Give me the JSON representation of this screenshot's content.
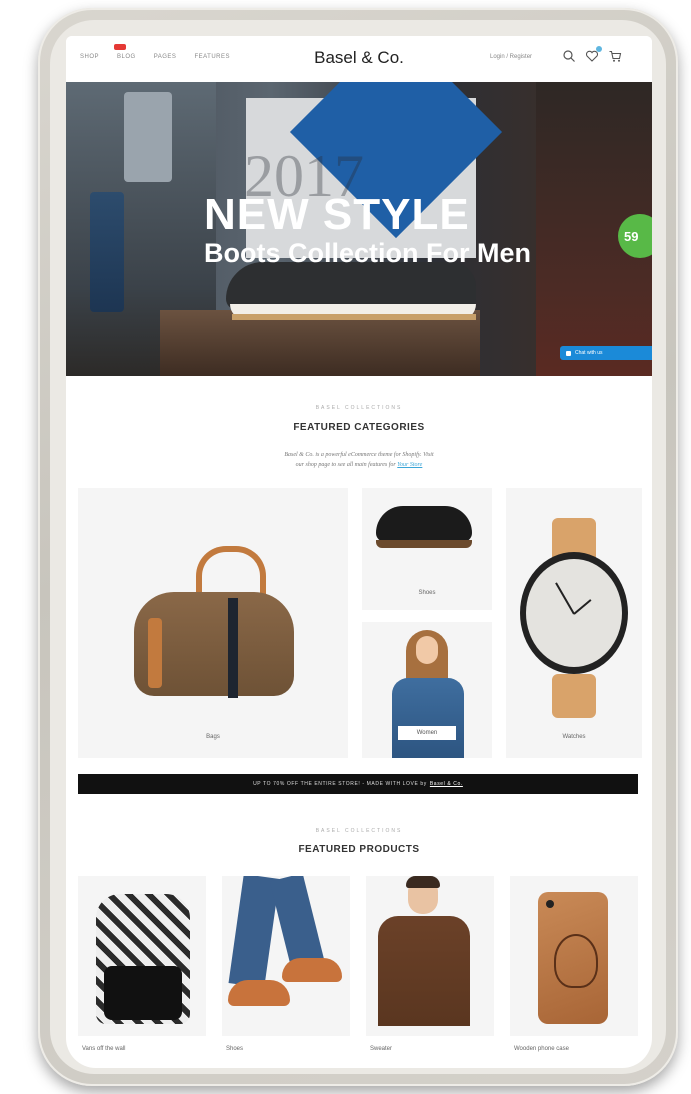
{
  "nav": {
    "links": [
      "Shop",
      "Blog",
      "Pages",
      "Features"
    ],
    "logo": "Basel & Co.",
    "account": "Login / Register"
  },
  "hero": {
    "background_year": "2017",
    "title": "NEW STYLE",
    "subtitle": "Boots Collection For Men",
    "price_tag": "59",
    "chat_button": "Chat with us"
  },
  "categories": {
    "kicker": "BASEL COLLECTIONS",
    "title": "FEATURED CATEGORIES",
    "description_line1": "Basel & Co. is a powerful eCommerce theme for Shopify. Visit",
    "description_line2": "our shop page to see all main features for",
    "description_link": "Your Store",
    "items": [
      {
        "label": "Bags"
      },
      {
        "label": "Shoes"
      },
      {
        "label": "Women"
      },
      {
        "label": "Watches"
      }
    ]
  },
  "promo": {
    "text": "UP TO 70% OFF THE ENTIRE STORE! - MADE WITH LOVE by",
    "link": "Basel & Co."
  },
  "products": {
    "kicker": "BASEL COLLECTIONS",
    "title": "FEATURED PRODUCTS",
    "items": [
      {
        "name": "Vans off the wall"
      },
      {
        "name": "Shoes"
      },
      {
        "name": "Sweater"
      },
      {
        "name": "Wooden phone case"
      }
    ]
  },
  "colors": {
    "accent_link": "#3ba6d8",
    "price_badge": "#58b947",
    "chat_button": "#1b8ad8",
    "promo_bar": "#111111",
    "hot_badge": "#e53935"
  },
  "icons": [
    "search-icon",
    "heart-icon",
    "cart-icon"
  ]
}
